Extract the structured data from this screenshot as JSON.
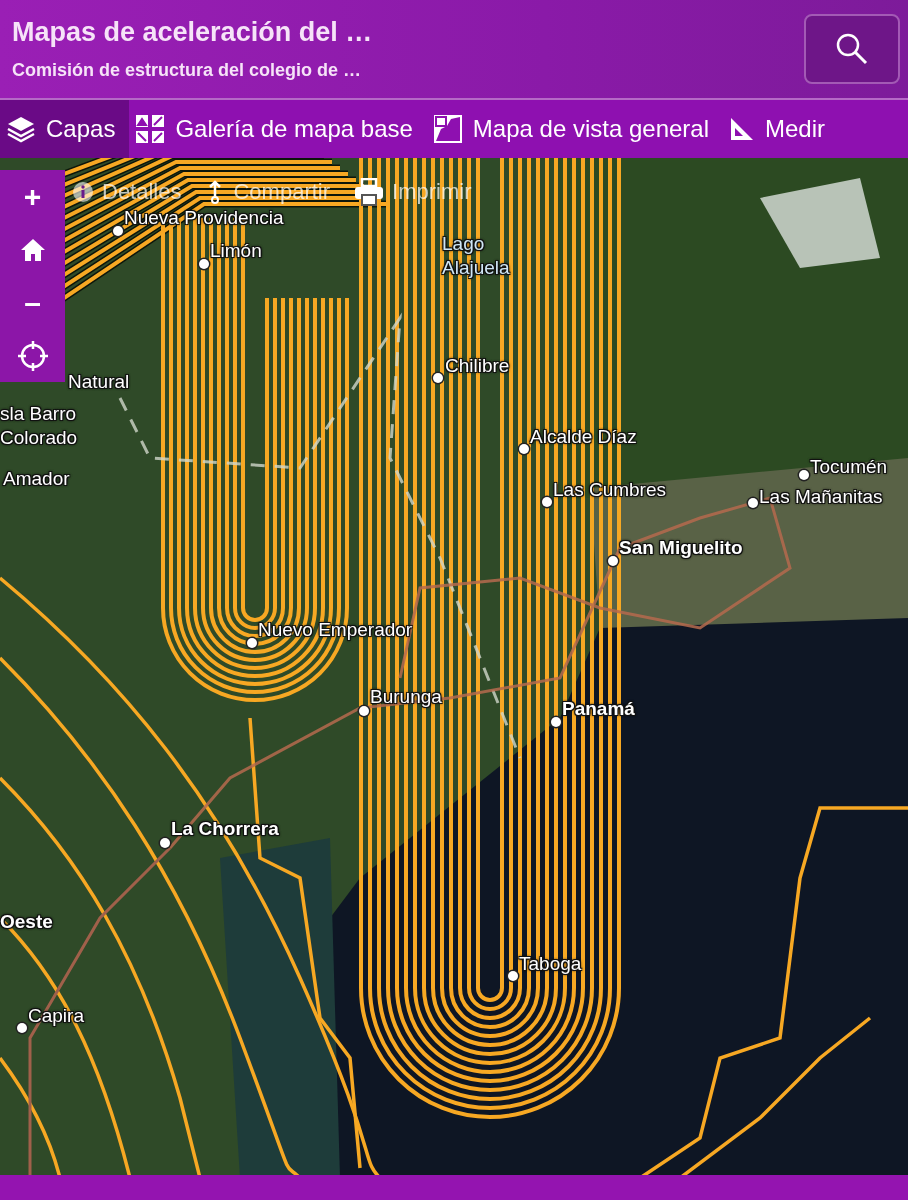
{
  "header": {
    "title": "Mapas de aceleración del …",
    "subtitle": "Comisión de estructura del colegio de …"
  },
  "toolbar": [
    {
      "label": "Capas",
      "kind": "layers",
      "selected": true
    },
    {
      "label": "Galería de mapa base",
      "kind": "gallery",
      "selected": false
    },
    {
      "label": "Mapa de vista general",
      "kind": "overview",
      "selected": false
    },
    {
      "label": "Medir",
      "kind": "measure",
      "selected": false
    }
  ],
  "actions": [
    {
      "label": "Detalles",
      "kind": "info"
    },
    {
      "label": "Compartir",
      "kind": "share"
    },
    {
      "label": "Imprimir",
      "kind": "print"
    }
  ],
  "map_controls": [
    {
      "kind": "zoom-in",
      "symbol": "+"
    },
    {
      "kind": "home"
    },
    {
      "kind": "zoom-out",
      "symbol": "–"
    },
    {
      "kind": "locate"
    }
  ],
  "map_labels": [
    {
      "text": "Nueva Providencia",
      "kind": "place",
      "bold": false,
      "dot": true
    },
    {
      "text": "Limón",
      "kind": "place",
      "bold": false,
      "dot": true
    },
    {
      "text": "Lago Alajuela",
      "kind": "water",
      "bold": false,
      "dot": false
    },
    {
      "text": "Chilibre",
      "kind": "place",
      "bold": false,
      "dot": true
    },
    {
      "text": "Natural",
      "kind": "place",
      "bold": false,
      "dot": false
    },
    {
      "text": "sla Barro Colorado",
      "kind": "place",
      "bold": false,
      "dot": false
    },
    {
      "text": "Amador",
      "kind": "place",
      "bold": false,
      "dot": false
    },
    {
      "text": "Alcalde Díaz",
      "kind": "place",
      "bold": false,
      "dot": true
    },
    {
      "text": "Las Cumbres",
      "kind": "place",
      "bold": false,
      "dot": true
    },
    {
      "text": "Tocumén",
      "kind": "place",
      "bold": false,
      "dot": true
    },
    {
      "text": "Las Mañanitas",
      "kind": "place",
      "bold": false,
      "dot": true
    },
    {
      "text": "San Miguelito",
      "kind": "place",
      "bold": true,
      "dot": true
    },
    {
      "text": "Nuevo Emperador",
      "kind": "place",
      "bold": false,
      "dot": true
    },
    {
      "text": "Burunga",
      "kind": "place",
      "bold": false,
      "dot": true
    },
    {
      "text": "Panamá",
      "kind": "place",
      "bold": true,
      "dot": true
    },
    {
      "text": "La Chorrera",
      "kind": "place",
      "bold": true,
      "dot": true
    },
    {
      "text": "Oeste",
      "kind": "place",
      "bold": true,
      "dot": false
    },
    {
      "text": "Taboga",
      "kind": "place",
      "bold": false,
      "dot": true
    },
    {
      "text": "Capira",
      "kind": "place",
      "bold": false,
      "dot": true
    }
  ]
}
